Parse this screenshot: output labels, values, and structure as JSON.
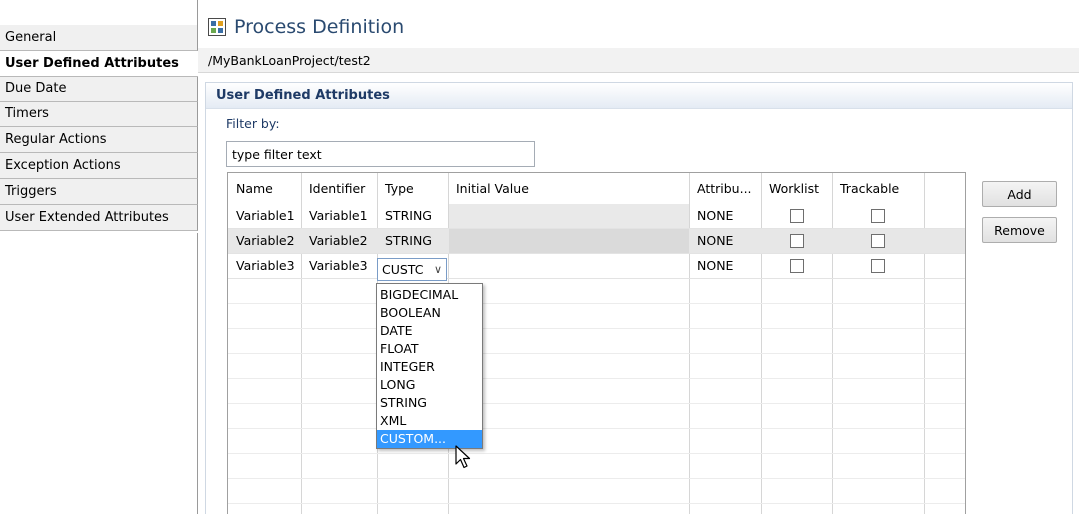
{
  "tabs": [
    {
      "label": "General"
    },
    {
      "label": "User Defined Attributes"
    },
    {
      "label": "Due Date"
    },
    {
      "label": "Timers"
    },
    {
      "label": "Regular Actions"
    },
    {
      "label": "Exception Actions"
    },
    {
      "label": "Triggers"
    },
    {
      "label": "User Extended Attributes"
    }
  ],
  "header": {
    "title": "Process Definition",
    "icon": "process-definition-icon",
    "breadcrumb": "/MyBankLoanProject/test2"
  },
  "section": {
    "title": "User Defined Attributes"
  },
  "filter": {
    "label": "Filter by:",
    "value": "type filter text"
  },
  "table": {
    "columns": [
      "Name",
      "Identifier",
      "Type",
      "Initial Value",
      "Attribu...",
      "Worklist",
      "Trackable"
    ],
    "rows": [
      {
        "name": "Variable1",
        "identifier": "Variable1",
        "type": "STRING",
        "initial_value": "",
        "attribute": "NONE",
        "worklist": false,
        "trackable": false
      },
      {
        "name": "Variable2",
        "identifier": "Variable2",
        "type": "STRING",
        "initial_value": "",
        "attribute": "NONE",
        "worklist": false,
        "trackable": false
      },
      {
        "name": "Variable3",
        "identifier": "Variable3",
        "type": "CUSTC",
        "initial_value": "",
        "attribute": "NONE",
        "worklist": false,
        "trackable": false
      }
    ]
  },
  "type_dropdown": {
    "options": [
      "BIGDECIMAL",
      "BOOLEAN",
      "DATE",
      "FLOAT",
      "INTEGER",
      "LONG",
      "STRING",
      "XML",
      "CUSTOM..."
    ],
    "highlighted": "CUSTOM..."
  },
  "buttons": {
    "add": "Add",
    "remove": "Remove"
  }
}
